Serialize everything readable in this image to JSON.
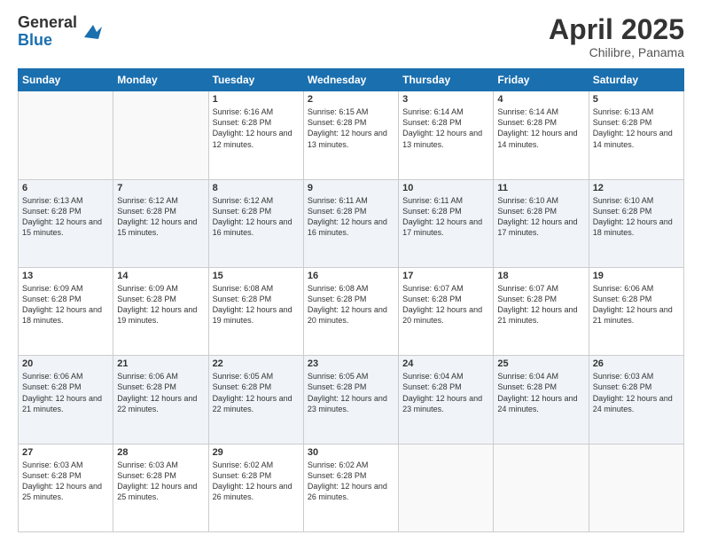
{
  "logo": {
    "general": "General",
    "blue": "Blue"
  },
  "header": {
    "month": "April 2025",
    "location": "Chilibre, Panama"
  },
  "weekdays": [
    "Sunday",
    "Monday",
    "Tuesday",
    "Wednesday",
    "Thursday",
    "Friday",
    "Saturday"
  ],
  "weeks": [
    [
      {
        "day": null,
        "info": null
      },
      {
        "day": null,
        "info": null
      },
      {
        "day": "1",
        "info": "Sunrise: 6:16 AM\nSunset: 6:28 PM\nDaylight: 12 hours and 12 minutes."
      },
      {
        "day": "2",
        "info": "Sunrise: 6:15 AM\nSunset: 6:28 PM\nDaylight: 12 hours and 13 minutes."
      },
      {
        "day": "3",
        "info": "Sunrise: 6:14 AM\nSunset: 6:28 PM\nDaylight: 12 hours and 13 minutes."
      },
      {
        "day": "4",
        "info": "Sunrise: 6:14 AM\nSunset: 6:28 PM\nDaylight: 12 hours and 14 minutes."
      },
      {
        "day": "5",
        "info": "Sunrise: 6:13 AM\nSunset: 6:28 PM\nDaylight: 12 hours and 14 minutes."
      }
    ],
    [
      {
        "day": "6",
        "info": "Sunrise: 6:13 AM\nSunset: 6:28 PM\nDaylight: 12 hours and 15 minutes."
      },
      {
        "day": "7",
        "info": "Sunrise: 6:12 AM\nSunset: 6:28 PM\nDaylight: 12 hours and 15 minutes."
      },
      {
        "day": "8",
        "info": "Sunrise: 6:12 AM\nSunset: 6:28 PM\nDaylight: 12 hours and 16 minutes."
      },
      {
        "day": "9",
        "info": "Sunrise: 6:11 AM\nSunset: 6:28 PM\nDaylight: 12 hours and 16 minutes."
      },
      {
        "day": "10",
        "info": "Sunrise: 6:11 AM\nSunset: 6:28 PM\nDaylight: 12 hours and 17 minutes."
      },
      {
        "day": "11",
        "info": "Sunrise: 6:10 AM\nSunset: 6:28 PM\nDaylight: 12 hours and 17 minutes."
      },
      {
        "day": "12",
        "info": "Sunrise: 6:10 AM\nSunset: 6:28 PM\nDaylight: 12 hours and 18 minutes."
      }
    ],
    [
      {
        "day": "13",
        "info": "Sunrise: 6:09 AM\nSunset: 6:28 PM\nDaylight: 12 hours and 18 minutes."
      },
      {
        "day": "14",
        "info": "Sunrise: 6:09 AM\nSunset: 6:28 PM\nDaylight: 12 hours and 19 minutes."
      },
      {
        "day": "15",
        "info": "Sunrise: 6:08 AM\nSunset: 6:28 PM\nDaylight: 12 hours and 19 minutes."
      },
      {
        "day": "16",
        "info": "Sunrise: 6:08 AM\nSunset: 6:28 PM\nDaylight: 12 hours and 20 minutes."
      },
      {
        "day": "17",
        "info": "Sunrise: 6:07 AM\nSunset: 6:28 PM\nDaylight: 12 hours and 20 minutes."
      },
      {
        "day": "18",
        "info": "Sunrise: 6:07 AM\nSunset: 6:28 PM\nDaylight: 12 hours and 21 minutes."
      },
      {
        "day": "19",
        "info": "Sunrise: 6:06 AM\nSunset: 6:28 PM\nDaylight: 12 hours and 21 minutes."
      }
    ],
    [
      {
        "day": "20",
        "info": "Sunrise: 6:06 AM\nSunset: 6:28 PM\nDaylight: 12 hours and 21 minutes."
      },
      {
        "day": "21",
        "info": "Sunrise: 6:06 AM\nSunset: 6:28 PM\nDaylight: 12 hours and 22 minutes."
      },
      {
        "day": "22",
        "info": "Sunrise: 6:05 AM\nSunset: 6:28 PM\nDaylight: 12 hours and 22 minutes."
      },
      {
        "day": "23",
        "info": "Sunrise: 6:05 AM\nSunset: 6:28 PM\nDaylight: 12 hours and 23 minutes."
      },
      {
        "day": "24",
        "info": "Sunrise: 6:04 AM\nSunset: 6:28 PM\nDaylight: 12 hours and 23 minutes."
      },
      {
        "day": "25",
        "info": "Sunrise: 6:04 AM\nSunset: 6:28 PM\nDaylight: 12 hours and 24 minutes."
      },
      {
        "day": "26",
        "info": "Sunrise: 6:03 AM\nSunset: 6:28 PM\nDaylight: 12 hours and 24 minutes."
      }
    ],
    [
      {
        "day": "27",
        "info": "Sunrise: 6:03 AM\nSunset: 6:28 PM\nDaylight: 12 hours and 25 minutes."
      },
      {
        "day": "28",
        "info": "Sunrise: 6:03 AM\nSunset: 6:28 PM\nDaylight: 12 hours and 25 minutes."
      },
      {
        "day": "29",
        "info": "Sunrise: 6:02 AM\nSunset: 6:28 PM\nDaylight: 12 hours and 26 minutes."
      },
      {
        "day": "30",
        "info": "Sunrise: 6:02 AM\nSunset: 6:28 PM\nDaylight: 12 hours and 26 minutes."
      },
      {
        "day": null,
        "info": null
      },
      {
        "day": null,
        "info": null
      },
      {
        "day": null,
        "info": null
      }
    ]
  ]
}
